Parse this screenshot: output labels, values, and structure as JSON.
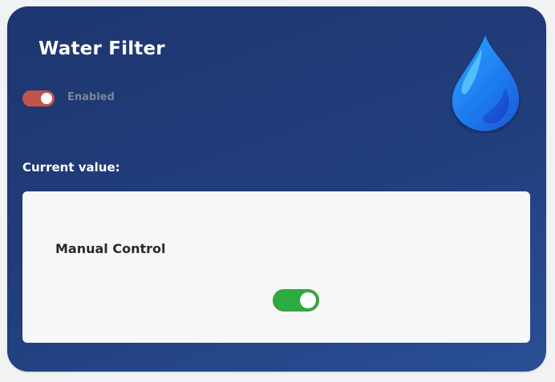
{
  "card": {
    "title": "Water Filter",
    "enabled_label": "Enabled",
    "enabled": true,
    "icon": "water-drop-icon",
    "current_value_label": "Current value:"
  },
  "panel": {
    "control_label": "Manual Control",
    "manual_on": true
  },
  "colors": {
    "card_background": "#213e7c",
    "enabled_toggle": "#c0554a",
    "manual_toggle": "#2cab3f",
    "panel_background": "#f6f7f9"
  }
}
